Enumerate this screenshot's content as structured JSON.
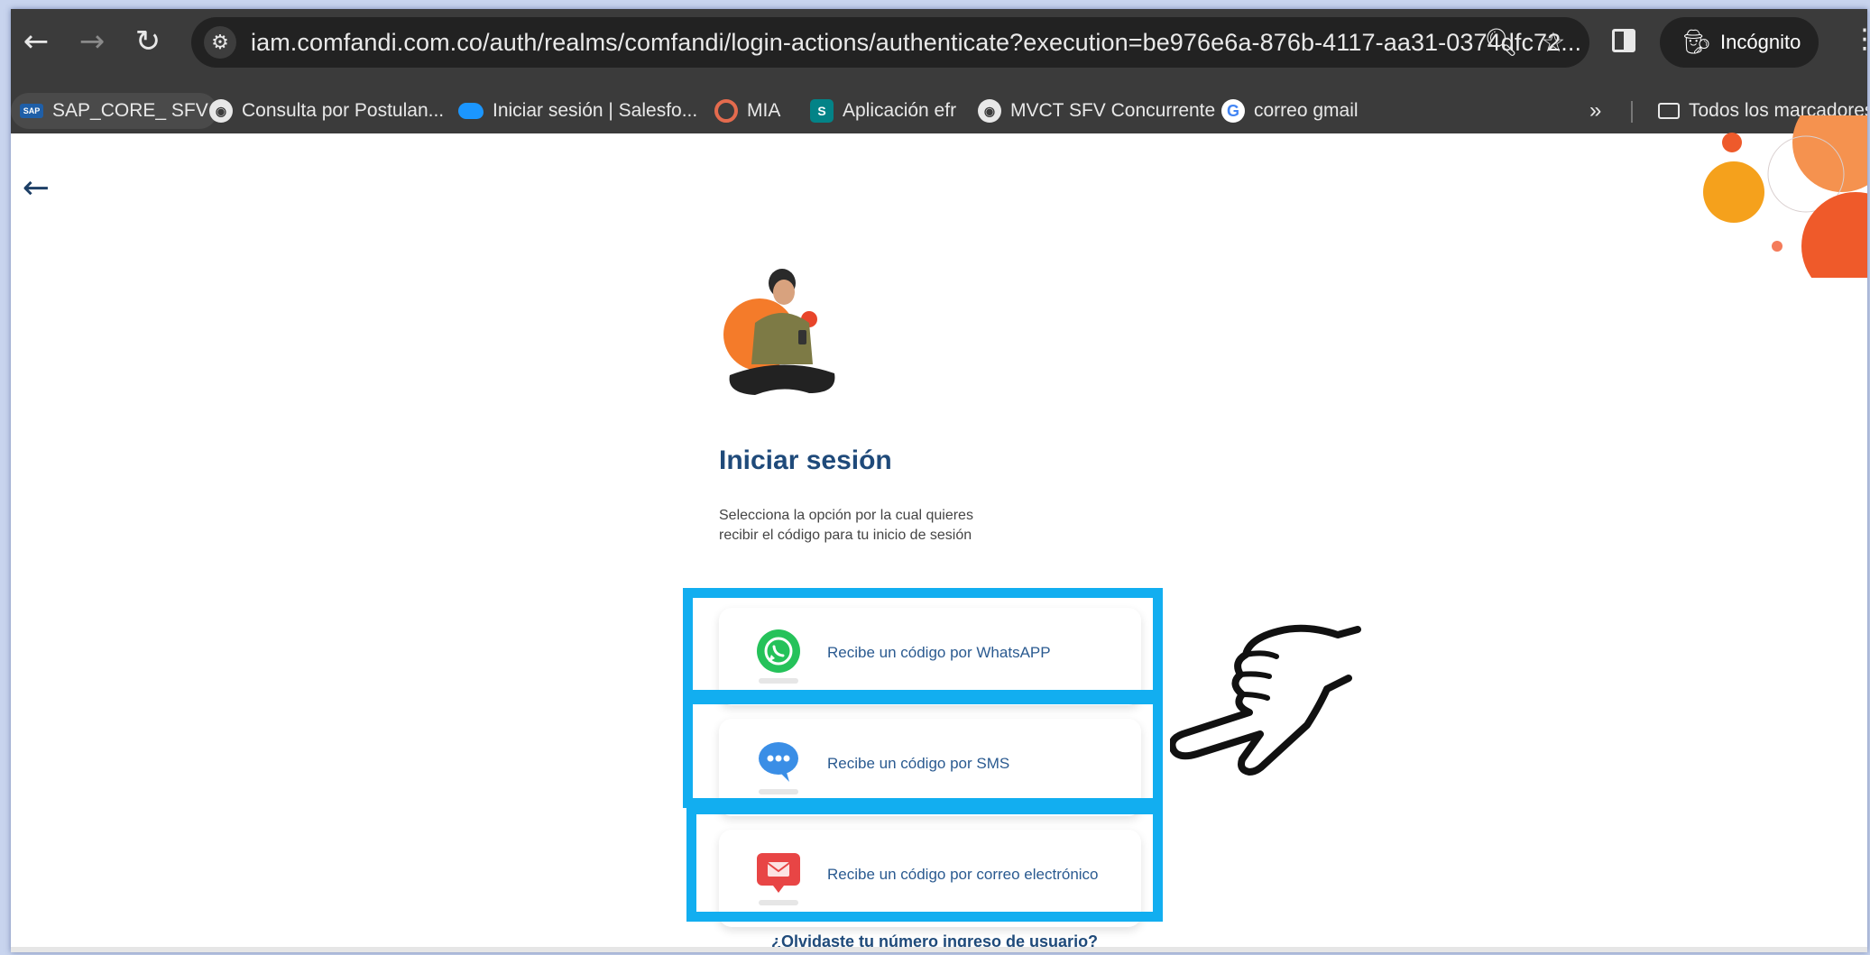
{
  "browser": {
    "url": "iam.comfandi.com.co/auth/realms/comfandi/login-actions/authenticate?execution=be976e6a-876b-4117-aa31-0374dfc72...",
    "incognito_label": "Incógnito",
    "icons": {
      "back": "back-arrow-icon",
      "forward": "forward-arrow-icon",
      "reload": "reload-icon",
      "site_info": "tune-icon",
      "zoom": "magnifier-icon",
      "bookmark": "star-icon",
      "side_panel": "side-panel-icon",
      "incognito": "incognito-icon",
      "menu": "kebab-menu-icon"
    }
  },
  "bookmarks": {
    "items": [
      {
        "label": "SAP_CORE_ SFV",
        "icon": "sap-logo-icon"
      },
      {
        "label": "Consulta por Postulan...",
        "icon": "globe-icon"
      },
      {
        "label": "Iniciar sesión | Salesfo...",
        "icon": "salesforce-cloud-icon"
      },
      {
        "label": "MIA",
        "icon": "spiral-icon"
      },
      {
        "label": "Aplicación efr",
        "icon": "sharepoint-icon"
      },
      {
        "label": "MVCT SFV Concurrente",
        "icon": "globe-icon"
      },
      {
        "label": "correo gmail",
        "icon": "google-icon"
      }
    ],
    "overflow": "»",
    "all_bookmarks": "Todos los marcadores"
  },
  "login": {
    "title": "Iniciar sesión",
    "description": "Selecciona la opción por la cual quieres recibir el código para tu inicio de sesión",
    "options": [
      {
        "label": "Recibe un código por WhatsAPP",
        "icon": "whatsapp-icon"
      },
      {
        "label": "Recibe un código por SMS",
        "icon": "chat-bubble-icon"
      },
      {
        "label": "Recibe un código por correo electrónico",
        "icon": "email-icon"
      }
    ],
    "forgot_link": "¿Olvidaste tu número ingreso de usuario?"
  },
  "colors": {
    "highlight": "#12aef0",
    "title": "#1f4a7a",
    "accent_orange": "#f47b2a"
  }
}
